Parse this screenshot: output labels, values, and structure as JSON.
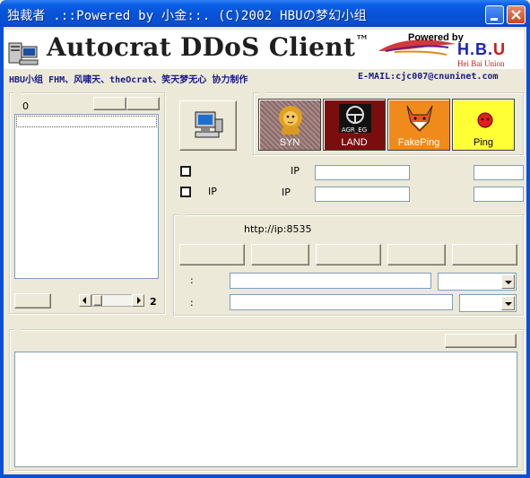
{
  "window": {
    "title": "独裁者 .::Powered by 小金::. (C)2002 HBUの梦幻小组"
  },
  "header": {
    "app_title": "Autocrat DDoS Client",
    "trademark": "™",
    "powered_by": "Powered by",
    "brand_hbu_part1": "H.B.",
    "brand_hbu_part2": "U",
    "brand_sub": "Hei Bai Union",
    "credits": "HBU小组 FHM、风啸天、theOcrat、笑天梦无心 协力制作",
    "email": "E-MAIL:cjc007@cnuninet.com"
  },
  "left_panel": {
    "count_label": "0",
    "page_value": "2"
  },
  "attacks": [
    {
      "id": "syn",
      "label": "SYN"
    },
    {
      "id": "land",
      "label": "LAND",
      "sublabel": "AGR_EG"
    },
    {
      "id": "fakeping",
      "label": "FakePing"
    },
    {
      "id": "ping",
      "label": "Ping"
    }
  ],
  "target": {
    "ip_label_1": "IP",
    "ip_label_2": "IP",
    "ip_label_3": "IP"
  },
  "server": {
    "url_text": "http://ip:8535",
    "colon_1": ":",
    "colon_2": ":"
  },
  "colors": {
    "titlebar": "#0a4fd8",
    "face": "#ece9d8",
    "syn_bg": "#8a6a6a",
    "land_bg": "#7a0e0e",
    "fakeping_bg": "#f08a1a",
    "ping_bg": "#ffff33"
  }
}
